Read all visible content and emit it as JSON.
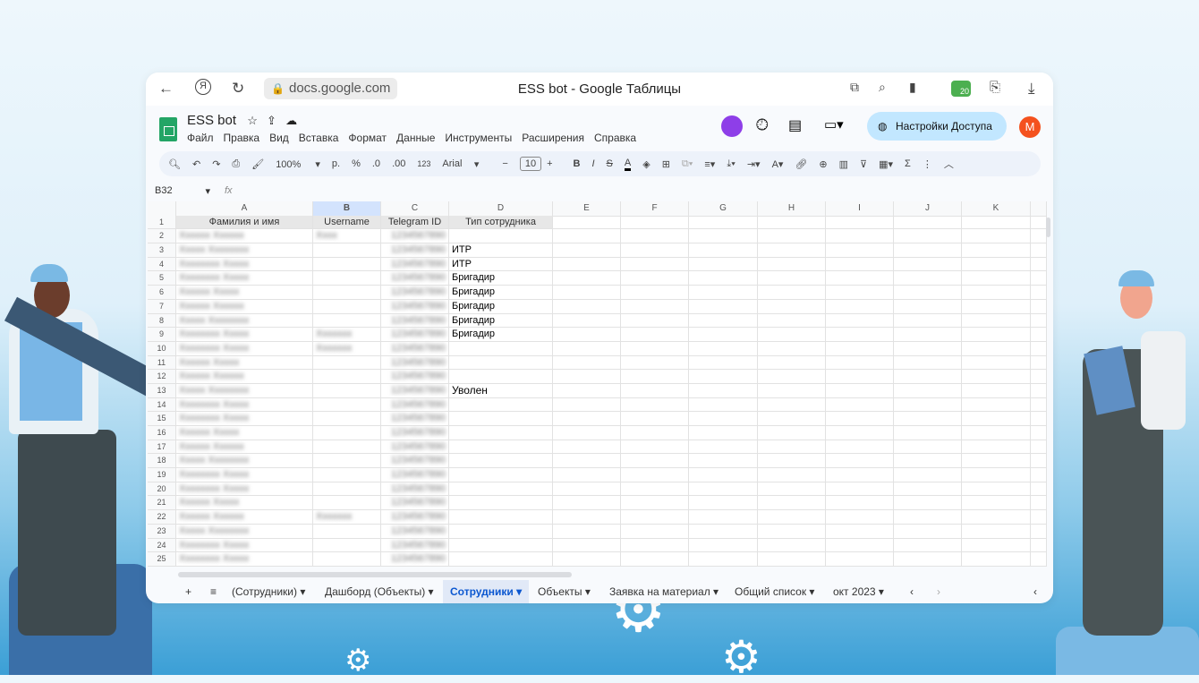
{
  "browser": {
    "url": "docs.google.com",
    "title": "ESS bot - Google Таблицы",
    "badge": "20"
  },
  "doc": {
    "name": "ESS bot",
    "menus": [
      "Файл",
      "Правка",
      "Вид",
      "Вставка",
      "Формат",
      "Данные",
      "Инструменты",
      "Расширения",
      "Справка"
    ],
    "share_label": "Настройки Доступа",
    "avatar": "M"
  },
  "toolbar": {
    "zoom": "100%",
    "currency": "р.",
    "percent": "%",
    "dec_less": ".0",
    "dec_more": ".00",
    "format": "123",
    "font": "Arial",
    "size": "10"
  },
  "formula": {
    "cell": "B32",
    "fx": "fx"
  },
  "columns": [
    "A",
    "B",
    "C",
    "D",
    "E",
    "F",
    "G",
    "H",
    "I",
    "J",
    "K"
  ],
  "headers": [
    "Фамилия и имя",
    "Username",
    "Telegram ID",
    "Тип сотрудника"
  ],
  "types": {
    "3": "ИТР",
    "4": "ИТР",
    "5": "Бригадир",
    "6": "Бригадир",
    "7": "Бригадир",
    "8": "Бригадир",
    "9": "Бригадир",
    "13": "Уволен"
  },
  "tabs": [
    "(Сотрудники)",
    "Дашборд (Объекты)",
    "Сотрудники",
    "Объекты",
    "Заявка на материал",
    "Общий список",
    "окт 2023"
  ]
}
